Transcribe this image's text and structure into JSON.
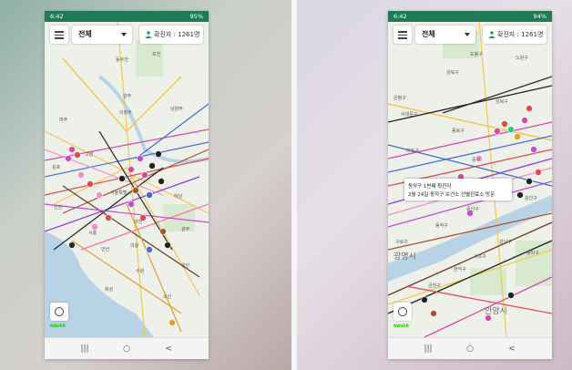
{
  "phones": [
    {
      "status_time": "6:42",
      "status_right": "95%",
      "region_select": "전체",
      "confirmed_label": "확진자 : 1261명",
      "map_labels": [
        "동두천",
        "포천",
        "양주",
        "의정부",
        "파주",
        "남양주",
        "김포",
        "고양",
        "서울특별시",
        "하남",
        "시흥",
        "안산",
        "과천",
        "의왕",
        "수원",
        "광주",
        "용인",
        "오산",
        "화성",
        "인천"
      ],
      "attribution": "NAVER",
      "nav": {
        "recents": "|||",
        "home": "○",
        "back": "<"
      }
    },
    {
      "status_time": "6:42",
      "status_right": "94%",
      "region_select": "전체",
      "confirmed_label": "확진자 : 1261명",
      "map_labels": [
        "노원구",
        "도봉구",
        "은평구",
        "강북구",
        "성북구",
        "서대문구",
        "종로구",
        "중구",
        "마포구",
        "용산구",
        "동작구",
        "광진구",
        "송파구",
        "강남구",
        "서초구",
        "관악구",
        "금천구",
        "구로구"
      ],
      "big_labels": [
        "광명시",
        "안양시"
      ],
      "tooltip": {
        "line1": "동작구 1번째 확진자",
        "line2": "2월 24일 동작구 보건소 선별진료소 방문"
      },
      "attribution": "NAVER",
      "nav": {
        "recents": "|||",
        "home": "○",
        "back": "<"
      }
    }
  ],
  "colors": {
    "status_bar": "#1f7a55",
    "map_bg": "#eef0ea",
    "road": "#f2c94c",
    "water": "#b9d3e6",
    "accent_person": "#1f9d6b"
  }
}
